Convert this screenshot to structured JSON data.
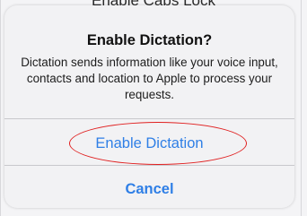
{
  "background": {
    "row_label": "Enable Caps Lock"
  },
  "alert": {
    "title": "Enable Dictation?",
    "message": "Dictation sends information like your voice input, contacts and location to Apple to process your requests.",
    "buttons": {
      "enable_label": "Enable Dictation",
      "cancel_label": "Cancel"
    }
  },
  "colors": {
    "button_text": "#2f7fe6",
    "annotation": "#e02020"
  }
}
